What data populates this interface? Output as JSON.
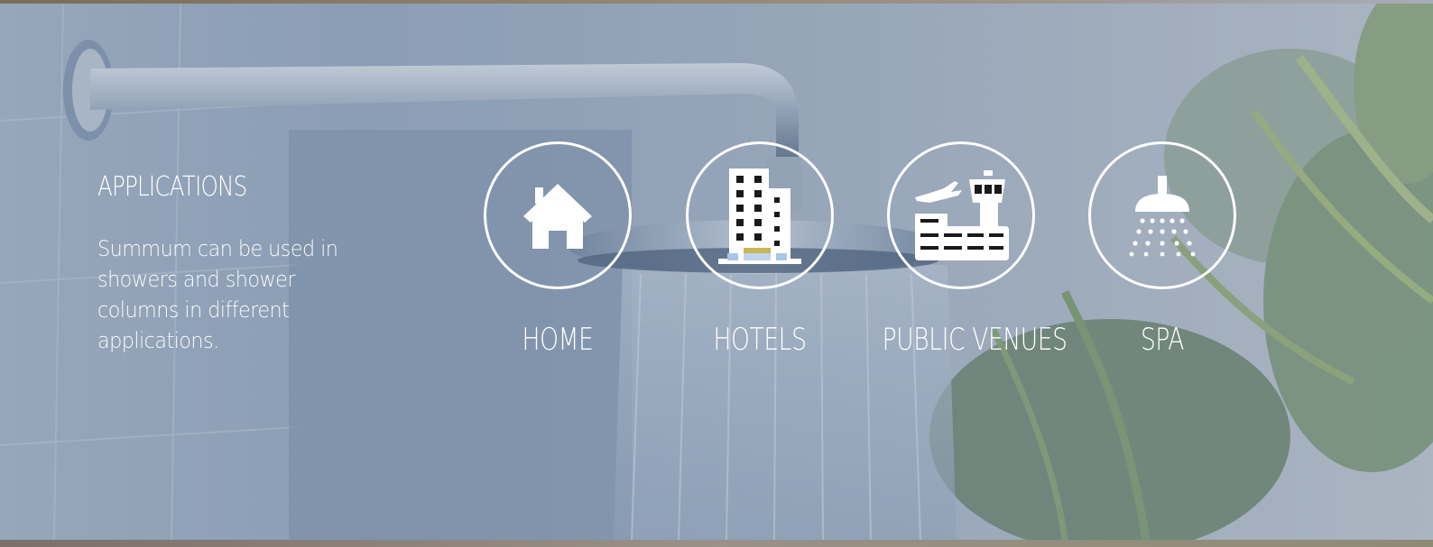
{
  "section": {
    "title": "APPLICATIONS",
    "description": "Summum can be used in showers and shower columns in different applications."
  },
  "applications": [
    {
      "label": "HOME",
      "icon": "home-icon"
    },
    {
      "label": "HOTELS",
      "icon": "hotel-building-icon"
    },
    {
      "label": "PUBLIC VENUES",
      "icon": "airport-icon"
    },
    {
      "label": "SPA",
      "icon": "shower-icon"
    }
  ],
  "colors": {
    "text": "#ffffff",
    "ring": "#ffffff",
    "overlay": "#5a6e8c"
  }
}
